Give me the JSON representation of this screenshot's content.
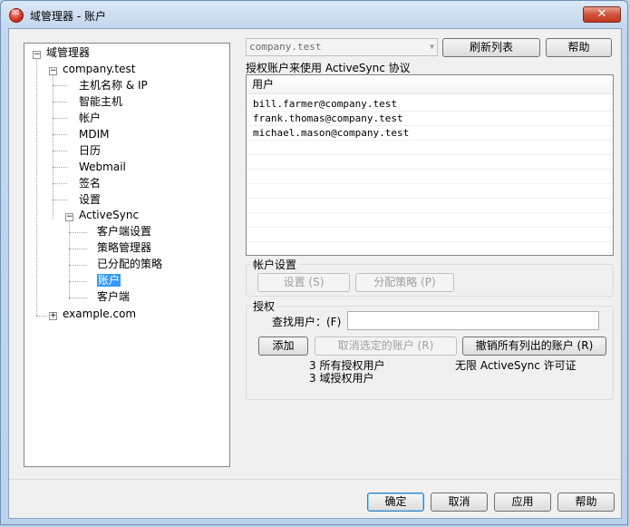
{
  "window": {
    "title": "域管理器 - 账户",
    "close_glyph": "✕"
  },
  "tree": {
    "root": "域管理器",
    "domain1": "company.test",
    "items": [
      "主机名称 & IP",
      "智能主机",
      "帐户",
      "MDIM",
      "日历",
      "Webmail",
      "签名",
      "设置"
    ],
    "activesync": "ActiveSync",
    "as_items": [
      "客户端设置",
      "策略管理器",
      "已分配的策略",
      "账户",
      "客户端"
    ],
    "domain2": "example.com",
    "selected": "账户"
  },
  "top": {
    "domain_select_value": "company.test",
    "refresh_label": "刷新列表",
    "help_label": "帮助",
    "auth_caption": "授权账户来使用 ActiveSync 协议"
  },
  "user_list": {
    "header": "用户",
    "rows": [
      "bill.farmer@company.test",
      "frank.thomas@company.test",
      "michael.mason@company.test"
    ]
  },
  "account_settings": {
    "title": "帐户设置",
    "settings_label": "设置 (S)",
    "assign_policy_label": "分配策略 (P)"
  },
  "authorization": {
    "title": "授权",
    "find_user_label": "查找用户：(F)",
    "find_user_value": "",
    "add_label": "添加",
    "revoke_selected_label": "取消选定的账户 (R)",
    "revoke_all_label": "撤销所有列出的账户 (R)",
    "all_authorized": "3 所有授权用户",
    "domain_authorized": "3 域授权用户",
    "license": "无限 ActiveSync 许可证"
  },
  "footer": {
    "ok_label": "确定",
    "cancel_label": "取消",
    "apply_label": "应用",
    "help_label": "帮助"
  }
}
